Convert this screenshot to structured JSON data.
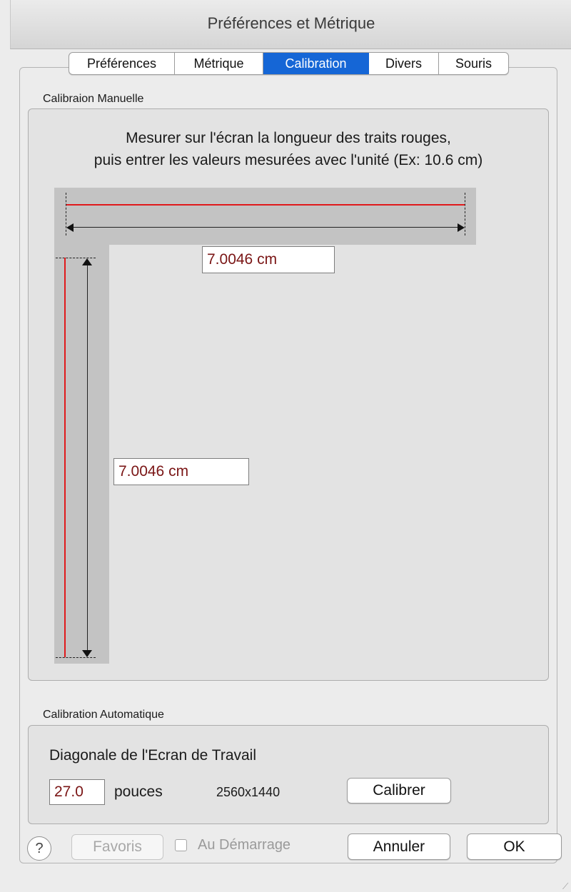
{
  "window": {
    "title": "Préférences et Métrique"
  },
  "tabs": [
    {
      "label": "Préférences",
      "selected": false
    },
    {
      "label": "Métrique",
      "selected": false
    },
    {
      "label": "Calibration",
      "selected": true
    },
    {
      "label": "Divers",
      "selected": false
    },
    {
      "label": "Souris",
      "selected": false
    }
  ],
  "manual": {
    "section_label": "Calibraion Manuelle",
    "instruction_line1": "Mesurer sur l'écran la longueur des traits rouges,",
    "instruction_line2": "puis entrer les valeurs mesurées avec l'unité (Ex: 10.6 cm)",
    "horizontal_value": "7.0046 cm",
    "vertical_value": "7.0046 cm"
  },
  "automatic": {
    "section_label": "Calibration Automatique",
    "diagonal_label": "Diagonale de l'Ecran de Travail",
    "diagonal_value": "27.0",
    "unit_label": "pouces",
    "resolution": "2560x1440",
    "calibrate_button": "Calibrer"
  },
  "footer": {
    "help_label": "?",
    "favorites_button": "Favoris",
    "startup_checkbox_label": "Au Démarrage",
    "startup_checked": false,
    "cancel_button": "Annuler",
    "ok_button": "OK"
  },
  "colors": {
    "accent": "#1566d6",
    "calibration_line": "#e0191c",
    "field_text": "#7a1515"
  }
}
